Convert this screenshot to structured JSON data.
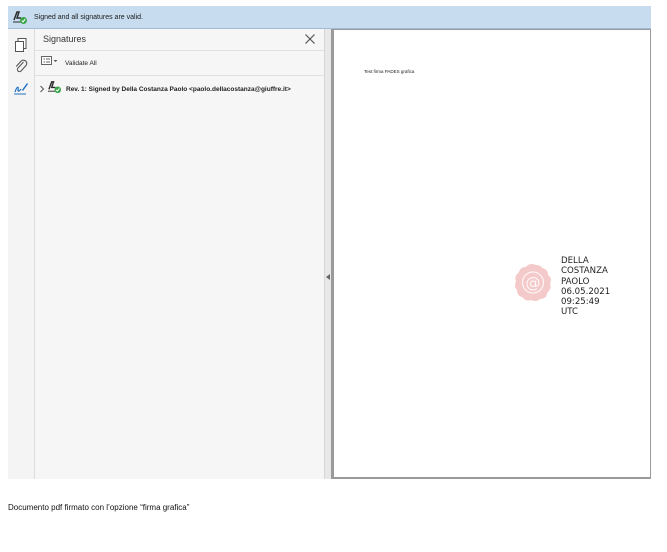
{
  "banner": {
    "message": "Signed and all signatures are valid."
  },
  "panel": {
    "title": "Signatures",
    "validate_all": "Validate All",
    "revision": "Rev. 1: Signed by Della Costanza Paolo <paolo.dellacostanza@giuffre.it>"
  },
  "document": {
    "text": "Test firma PADES grafica",
    "signature_lines": [
      "DELLA",
      "COSTANZA",
      "PAOLO",
      "06.05.2021",
      "09:25:49",
      "UTC"
    ]
  },
  "caption": "Documento pdf firmato con l’opzione “firma grafica”",
  "icons": {
    "banner": "signature-valid-icon",
    "tool_pages": "page-thumbnails-icon",
    "tool_attach": "paperclip-icon",
    "tool_sign": "signature-pen-icon",
    "close": "close-icon",
    "validate": "list-options-icon",
    "expand": "chevron-right-icon",
    "rev": "signature-valid-icon",
    "seal": "wax-seal-icon"
  },
  "colors": {
    "banner_bg": "#c7dcef",
    "valid_green": "#3aa548",
    "seal": "#f0b8b8"
  }
}
